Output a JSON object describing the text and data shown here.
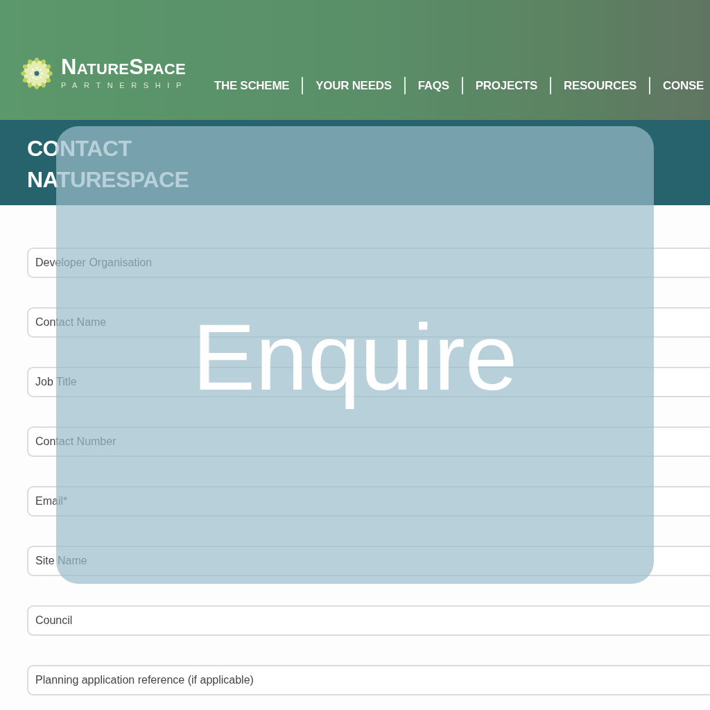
{
  "header": {
    "logo": {
      "wordmark": "NatureSpace",
      "tagline": "PARTNERSHIP"
    },
    "nav": [
      {
        "label": "THE SCHEME"
      },
      {
        "label": "YOUR NEEDS"
      },
      {
        "label": "FAQS"
      },
      {
        "label": "PROJECTS"
      },
      {
        "label": "RESOURCES"
      },
      {
        "label": "CONSE"
      }
    ]
  },
  "page_title": "CONTACT NATURESPACE",
  "form": {
    "fields": [
      {
        "placeholder": "Developer Organisation"
      },
      {
        "placeholder": "Contact Name"
      },
      {
        "placeholder": "Job Title"
      },
      {
        "placeholder": "Contact Number"
      },
      {
        "placeholder": "Email*"
      },
      {
        "placeholder": "Site Name"
      },
      {
        "placeholder": "Council"
      },
      {
        "placeholder": "Planning application reference (if applicable)"
      }
    ]
  },
  "overlay": {
    "text": "Enquire"
  }
}
